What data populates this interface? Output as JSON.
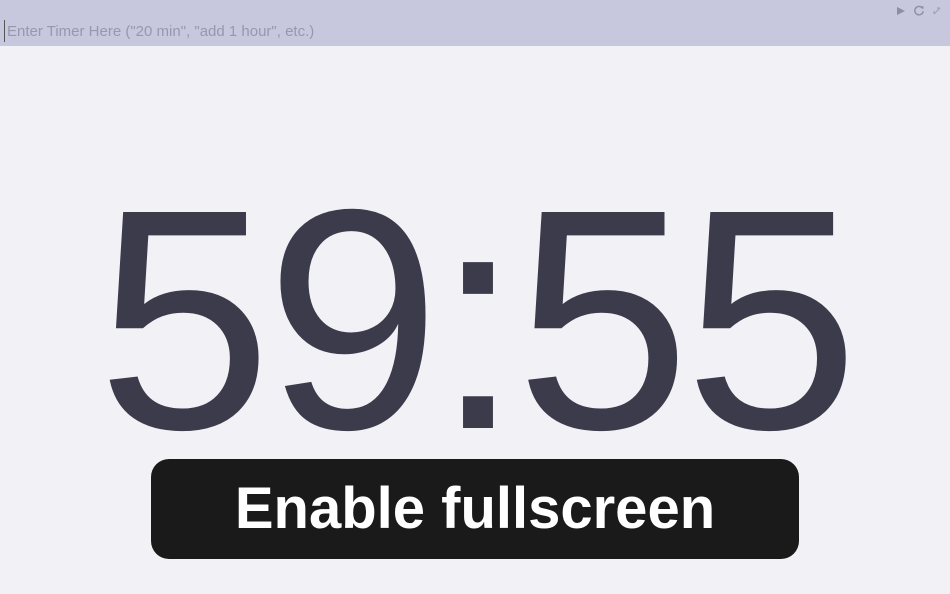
{
  "input": {
    "placeholder": "Enter Timer Here (\"20 min\", \"add 1 hour\", etc.)",
    "value": ""
  },
  "controls": {
    "play_icon": "play-icon",
    "restart_icon": "restart-icon",
    "close_icon": "close-icon"
  },
  "timer": {
    "display": "59:55"
  },
  "fullscreen_button": {
    "label": "Enable fullscreen"
  },
  "colors": {
    "topbar": "#c7c7de",
    "background": "#f2f1f6",
    "digits": "#3c3b4b",
    "button_bg": "#1a1a1a",
    "button_text": "#ffffff"
  }
}
